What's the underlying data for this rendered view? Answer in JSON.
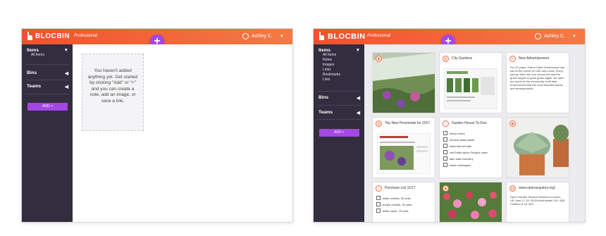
{
  "app": {
    "brand": "BLOCBIN",
    "tier": "Professional",
    "user": "Ashley C.",
    "accent": "#f0522d",
    "purple": "#a347e5"
  },
  "left": {
    "sidebar": {
      "items_title": "Items",
      "items_sub": [
        "All items"
      ],
      "bins": "Bins",
      "teams": "Teams",
      "add": "ADD +"
    },
    "empty_state": "You haven't added anything yet. Get started by clicking \"Add\" or \"+\" and you can create a note, add an image, or save a link."
  },
  "right": {
    "sidebar": {
      "items_title": "Items",
      "items_sub": [
        "All Items",
        "Notes",
        "Images",
        "Links",
        "Bookmarks",
        "Lists"
      ],
      "bins": "Bins",
      "teams": "Teams",
      "add": "ADD +"
    },
    "cards": {
      "city_gardens": "City Gardens",
      "new_ad": "New Advertisement",
      "new_ad_text": "For 20 years, Green Oaks Greenhouse has sat on the corner of 10th and Lewis. Every spring, when the sun comes out and the grass begins to grow green again, we open our doors to the community to fill their environment with the most beautiful plants and arrangements.",
      "perennials": "Top New Perennials for 2017",
      "todo_title": "Garden House To-Dos",
      "todo": [
        "check hours",
        "remove dead plants",
        "weed the left side",
        "call Eddie about Friday's order",
        "take total inventory",
        "return messages"
      ],
      "purchase_title": "Purchase List 11/17",
      "purchase": [
        "white orchids, 30 units",
        "purple orchids, 30 units",
        "white roses, 75 units"
      ],
      "link_title": "www.openacquires.org/",
      "link_text": "Open Garden Season Weekend London, UK June 17-18, 2018 Adult tickets 18+: $38 Children 5-16: $15"
    }
  }
}
